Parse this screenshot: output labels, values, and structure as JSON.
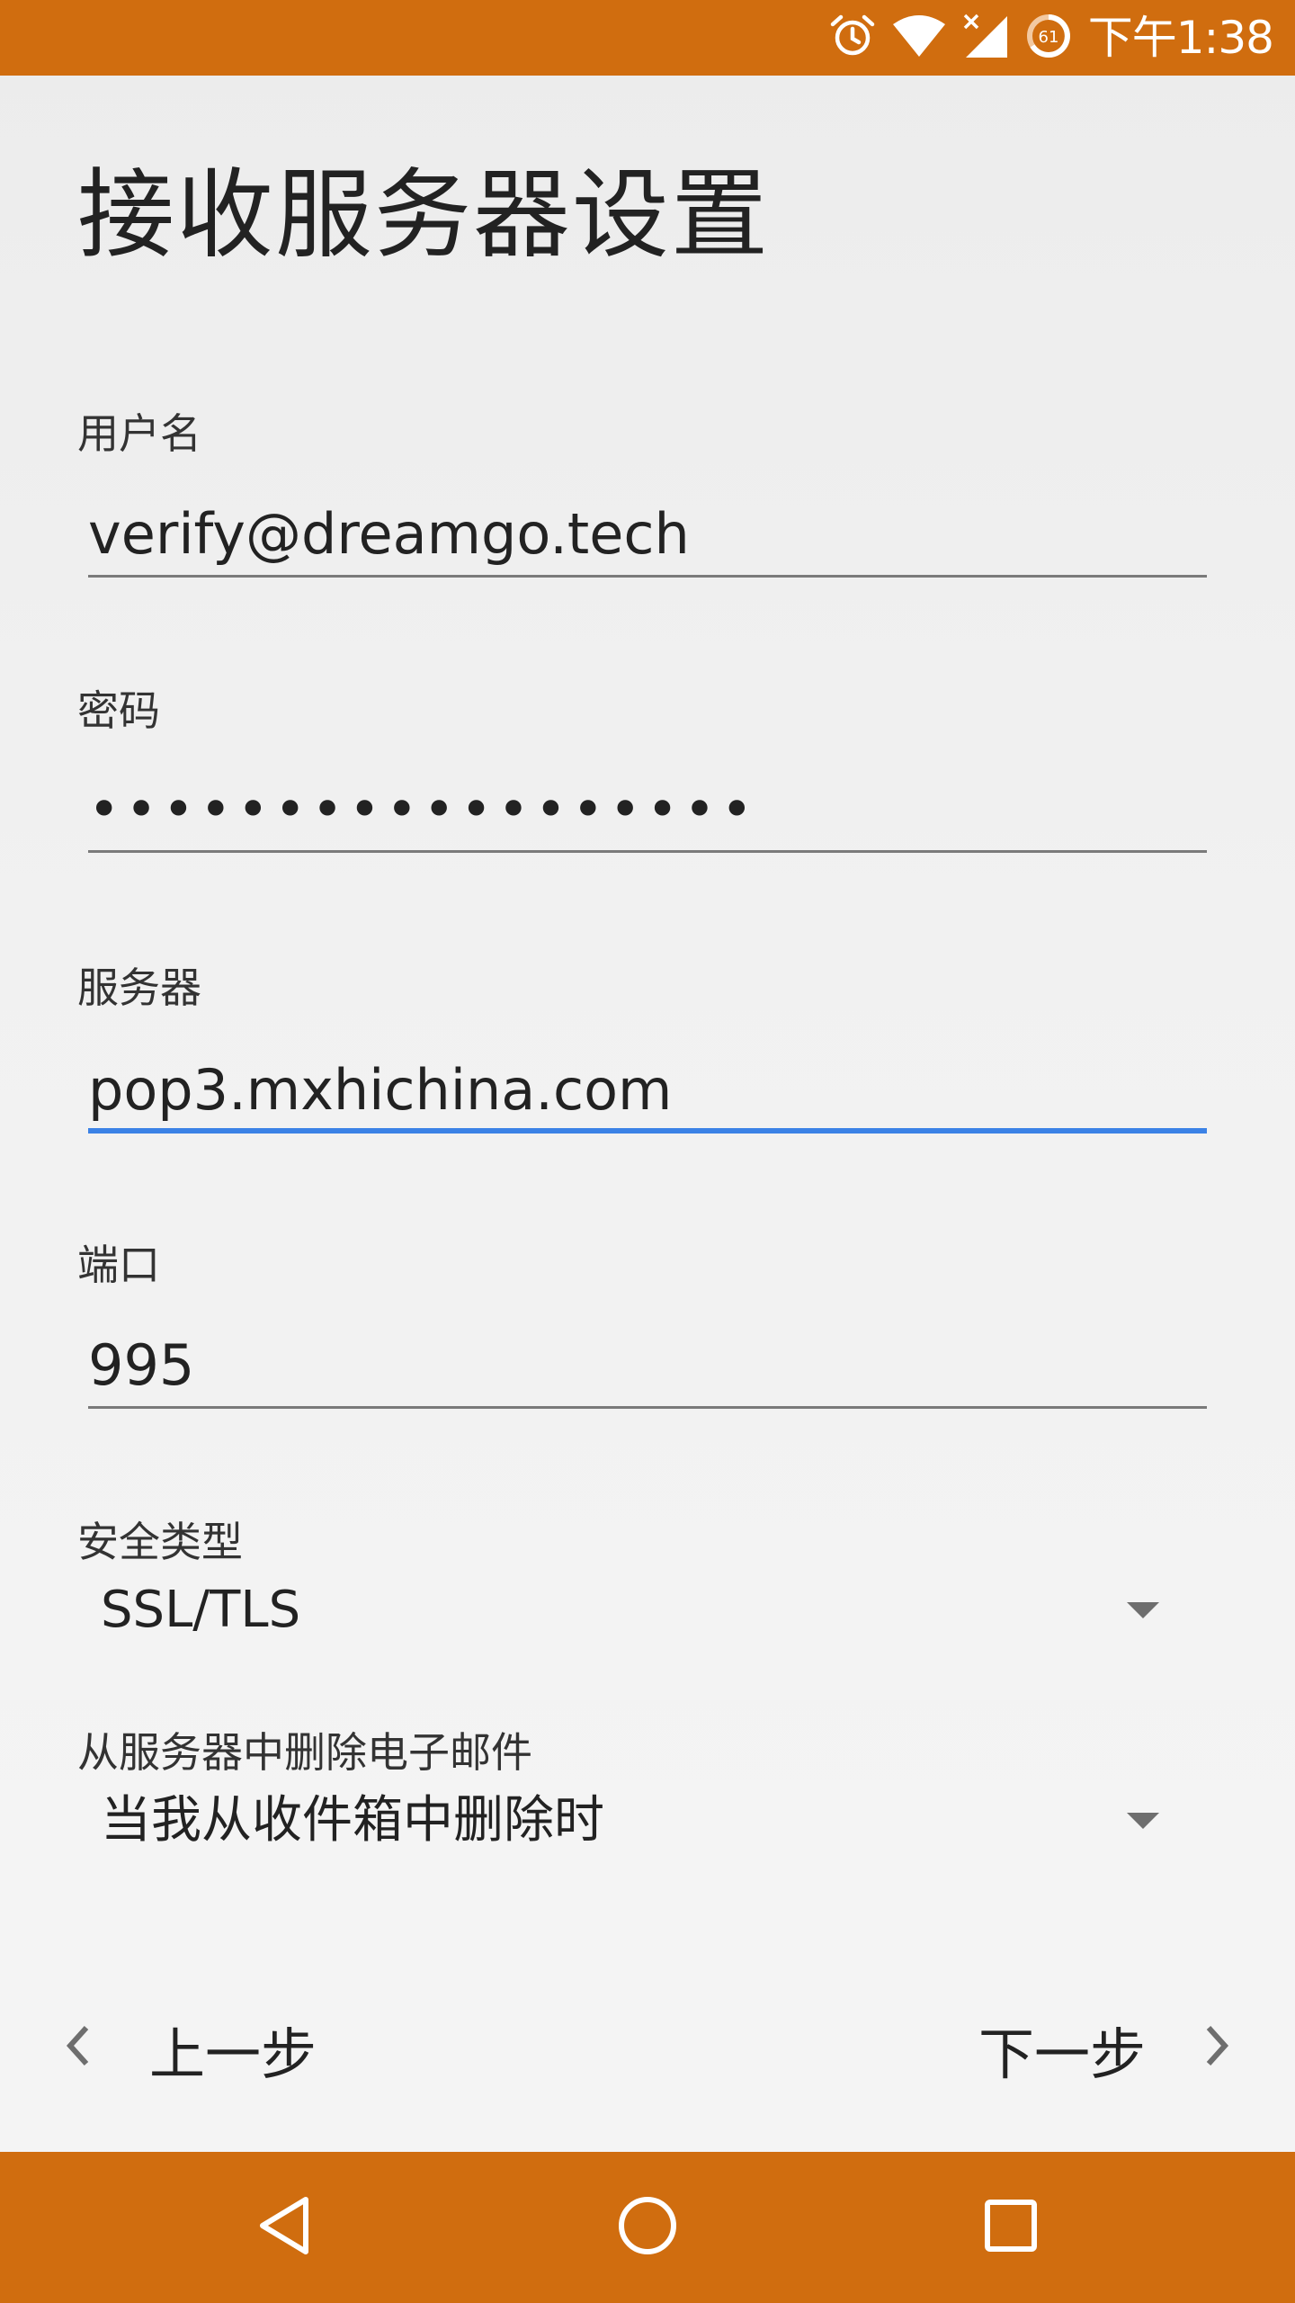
{
  "status_bar": {
    "time": "下午1:38",
    "battery_level": "61",
    "icons": [
      "alarm-icon",
      "wifi-icon",
      "signal-no-data-icon",
      "battery-saver-icon"
    ]
  },
  "page": {
    "title": "接收服务器设置"
  },
  "form": {
    "username": {
      "label": "用户名",
      "value": "verify@dreamgo.tech"
    },
    "password": {
      "label": "密码",
      "value": "••••••••••••••••••"
    },
    "server": {
      "label": "服务器",
      "value": "pop3.mxhichina.com"
    },
    "port": {
      "label": "端口",
      "value": "995"
    },
    "security_type": {
      "label": "安全类型",
      "value": "SSL/TLS"
    },
    "delete_from_server": {
      "label": "从服务器中删除电子邮件",
      "value": "当我从收件箱中删除时"
    }
  },
  "actions": {
    "previous_label": "上一步",
    "next_label": "下一步"
  },
  "system_nav": {
    "icons": [
      "back-icon",
      "home-icon",
      "recents-icon"
    ]
  },
  "colors": {
    "accent": "#d06d0f",
    "focus": "#3b82e6"
  }
}
